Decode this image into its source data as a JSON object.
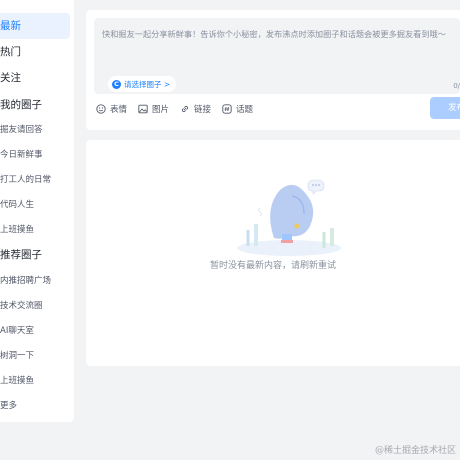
{
  "sidebar": {
    "items": [
      {
        "label": "最新",
        "kind": "main",
        "active": true
      },
      {
        "label": "热门",
        "kind": "main"
      },
      {
        "label": "关注",
        "kind": "main"
      },
      {
        "label": "我的圈子",
        "kind": "main"
      },
      {
        "label": "掘友请回答",
        "kind": "sub"
      },
      {
        "label": "今日新鲜事",
        "kind": "sub"
      },
      {
        "label": "打工人的日常",
        "kind": "sub"
      },
      {
        "label": "代码人生",
        "kind": "sub"
      },
      {
        "label": "上班摸鱼",
        "kind": "sub"
      },
      {
        "label": "推荐圈子",
        "kind": "main"
      },
      {
        "label": "内推招聘广场",
        "kind": "sub"
      },
      {
        "label": "技术交流圈",
        "kind": "sub"
      },
      {
        "label": "AI聊天室",
        "kind": "sub"
      },
      {
        "label": "树洞一下",
        "kind": "sub"
      },
      {
        "label": "上班摸鱼",
        "kind": "sub"
      },
      {
        "label": "更多",
        "kind": "sub"
      }
    ]
  },
  "composer": {
    "placeholder": "快和掘友一起分享新鲜事！告诉你个小秘密，发布沸点时添加圈子和话题会被更多掘友看到哦～",
    "circle_chip": "请选择圈子 >",
    "counter": "0/",
    "tools": {
      "emoji": "表情",
      "image": "图片",
      "link": "链接",
      "topic": "话题"
    },
    "publish": "发布",
    "accent_color": "#1e80ff"
  },
  "feed": {
    "empty_text": "暂时没有最新内容，请刷新重试"
  },
  "watermark": "@稀土掘金技术社区"
}
